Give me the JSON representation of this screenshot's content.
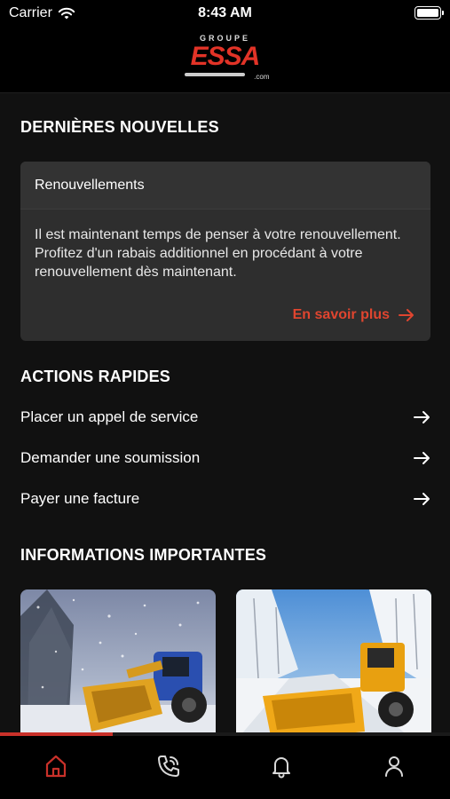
{
  "status_bar": {
    "carrier": "Carrier",
    "time": "8:43 AM"
  },
  "logo": {
    "top": "GROUPE",
    "main": "ESSA",
    "suffix": ".com"
  },
  "news": {
    "section_title": "DERNIÈRES NOUVELLES",
    "card_title": "Renouvellements",
    "card_body": "Il est maintenant temps de penser à votre renouvellement. Profitez d'un rabais additionnel en procédant à votre renouvellement dès maintenant.",
    "link_label": "En savoir plus"
  },
  "quick_actions": {
    "section_title": "ACTIONS RAPIDES",
    "items": [
      {
        "label": "Placer un appel de service"
      },
      {
        "label": "Demander une soumission"
      },
      {
        "label": "Payer une facture"
      }
    ]
  },
  "important_info": {
    "section_title": "INFORMATIONS IMPORTANTES"
  },
  "carousel": {
    "progress": 0.25
  },
  "tabs": [
    {
      "icon": "home-icon",
      "active": true
    },
    {
      "icon": "phone-call-icon",
      "active": false
    },
    {
      "icon": "bell-icon",
      "active": false
    },
    {
      "icon": "user-icon",
      "active": false
    }
  ],
  "colors": {
    "accent": "#e0452f",
    "background": "#111111",
    "card": "#2e2e2e",
    "tab_active": "#c9312a",
    "tab_inactive": "#d8d8d8"
  }
}
